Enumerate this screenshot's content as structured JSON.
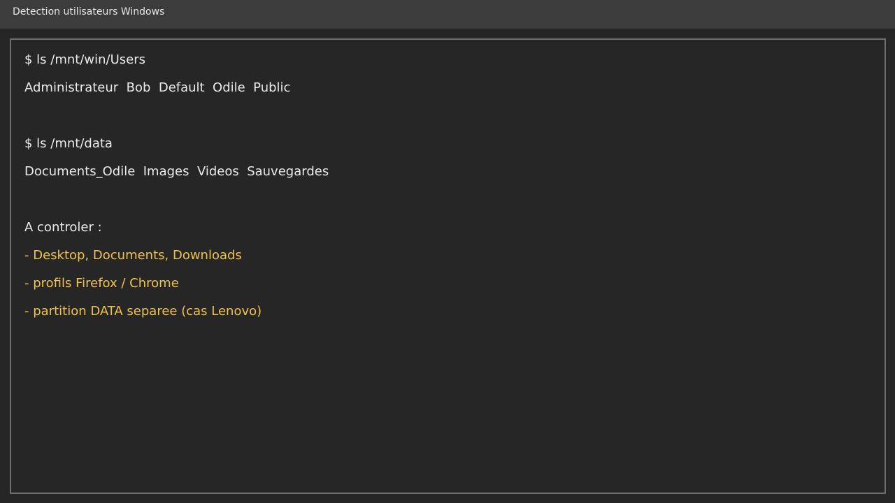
{
  "window": {
    "title": "Detection utilisateurs Windows"
  },
  "terminal": {
    "lines": [
      {
        "text": "$ ls /mnt/win/Users",
        "highlight": false
      },
      {
        "text": "Administrateur  Bob  Default  Odile  Public",
        "highlight": false
      },
      {
        "text": "$ ls /mnt/data",
        "highlight": false
      },
      {
        "text": "Documents_Odile  Images  Videos  Sauvegardes",
        "highlight": false
      },
      {
        "text": "A controler :",
        "highlight": false
      },
      {
        "text": "- Desktop, Documents, Downloads",
        "highlight": true
      },
      {
        "text": "- profils Firefox / Chrome",
        "highlight": true
      },
      {
        "text": "- partition DATA separee (cas Lenovo)",
        "highlight": true
      }
    ]
  },
  "colors": {
    "background": "#262626",
    "titlebar": "#3c3c3c",
    "text": "#eaeaea",
    "highlight": "#f0c24b",
    "border": "#6e6e6e"
  }
}
